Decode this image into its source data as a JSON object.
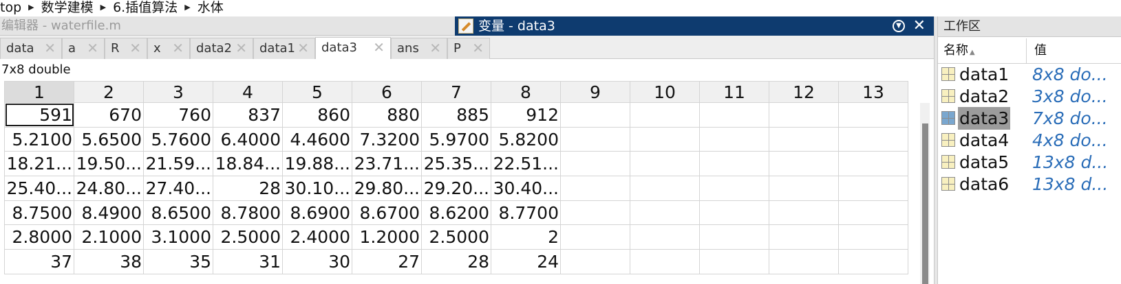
{
  "breadcrumb": [
    "top",
    "数学建模",
    "6.插值算法",
    "水体"
  ],
  "editor": {
    "title": "编辑器 - waterfile.m"
  },
  "variable_window": {
    "title": "变量 - data3",
    "menu_icon": "dropdown-circle-icon",
    "close_glyph": "✕"
  },
  "tabs": [
    {
      "label": "data",
      "active": false
    },
    {
      "label": "a",
      "active": false
    },
    {
      "label": "R",
      "active": false
    },
    {
      "label": "x",
      "active": false
    },
    {
      "label": "data2",
      "active": false
    },
    {
      "label": "data1",
      "active": false
    },
    {
      "label": "data3",
      "active": true
    },
    {
      "label": "ans",
      "active": false
    },
    {
      "label": "P",
      "active": false
    }
  ],
  "tab_close_glyph": "✕",
  "variable_info": "7x8 double",
  "grid": {
    "columns": [
      "1",
      "2",
      "3",
      "4",
      "5",
      "6",
      "7",
      "8",
      "9",
      "10",
      "11",
      "12",
      "13"
    ],
    "rows": [
      [
        "591",
        "670",
        "760",
        "837",
        "860",
        "880",
        "885",
        "912"
      ],
      [
        "5.2100",
        "5.6500",
        "5.7600",
        "6.4000",
        "4.4600",
        "7.3200",
        "5.9700",
        "5.8200"
      ],
      [
        "18.21...",
        "19.50...",
        "21.59...",
        "18.84...",
        "19.88...",
        "23.71...",
        "25.35...",
        "22.51..."
      ],
      [
        "25.40...",
        "24.80...",
        "27.40...",
        "28",
        "30.10...",
        "29.80...",
        "29.20...",
        "30.40..."
      ],
      [
        "8.7500",
        "8.4900",
        "8.6500",
        "8.7800",
        "8.6900",
        "8.6700",
        "8.6200",
        "8.7700"
      ],
      [
        "2.8000",
        "2.1000",
        "3.1000",
        "2.5000",
        "2.4000",
        "1.2000",
        "2.5000",
        "2"
      ],
      [
        "37",
        "38",
        "35",
        "31",
        "30",
        "27",
        "28",
        "24"
      ]
    ]
  },
  "workspace": {
    "title": "工作区",
    "col_name": "名称",
    "col_value": "值",
    "sort_glyph": "▲",
    "items": [
      {
        "name": "data1",
        "value": "8x8 do..."
      },
      {
        "name": "data2",
        "value": "3x8 do..."
      },
      {
        "name": "data3",
        "value": "7x8 do...",
        "selected": true
      },
      {
        "name": "data4",
        "value": "4x8 do..."
      },
      {
        "name": "data5",
        "value": "13x8 d..."
      },
      {
        "name": "data6",
        "value": "13x8 d..."
      }
    ]
  }
}
